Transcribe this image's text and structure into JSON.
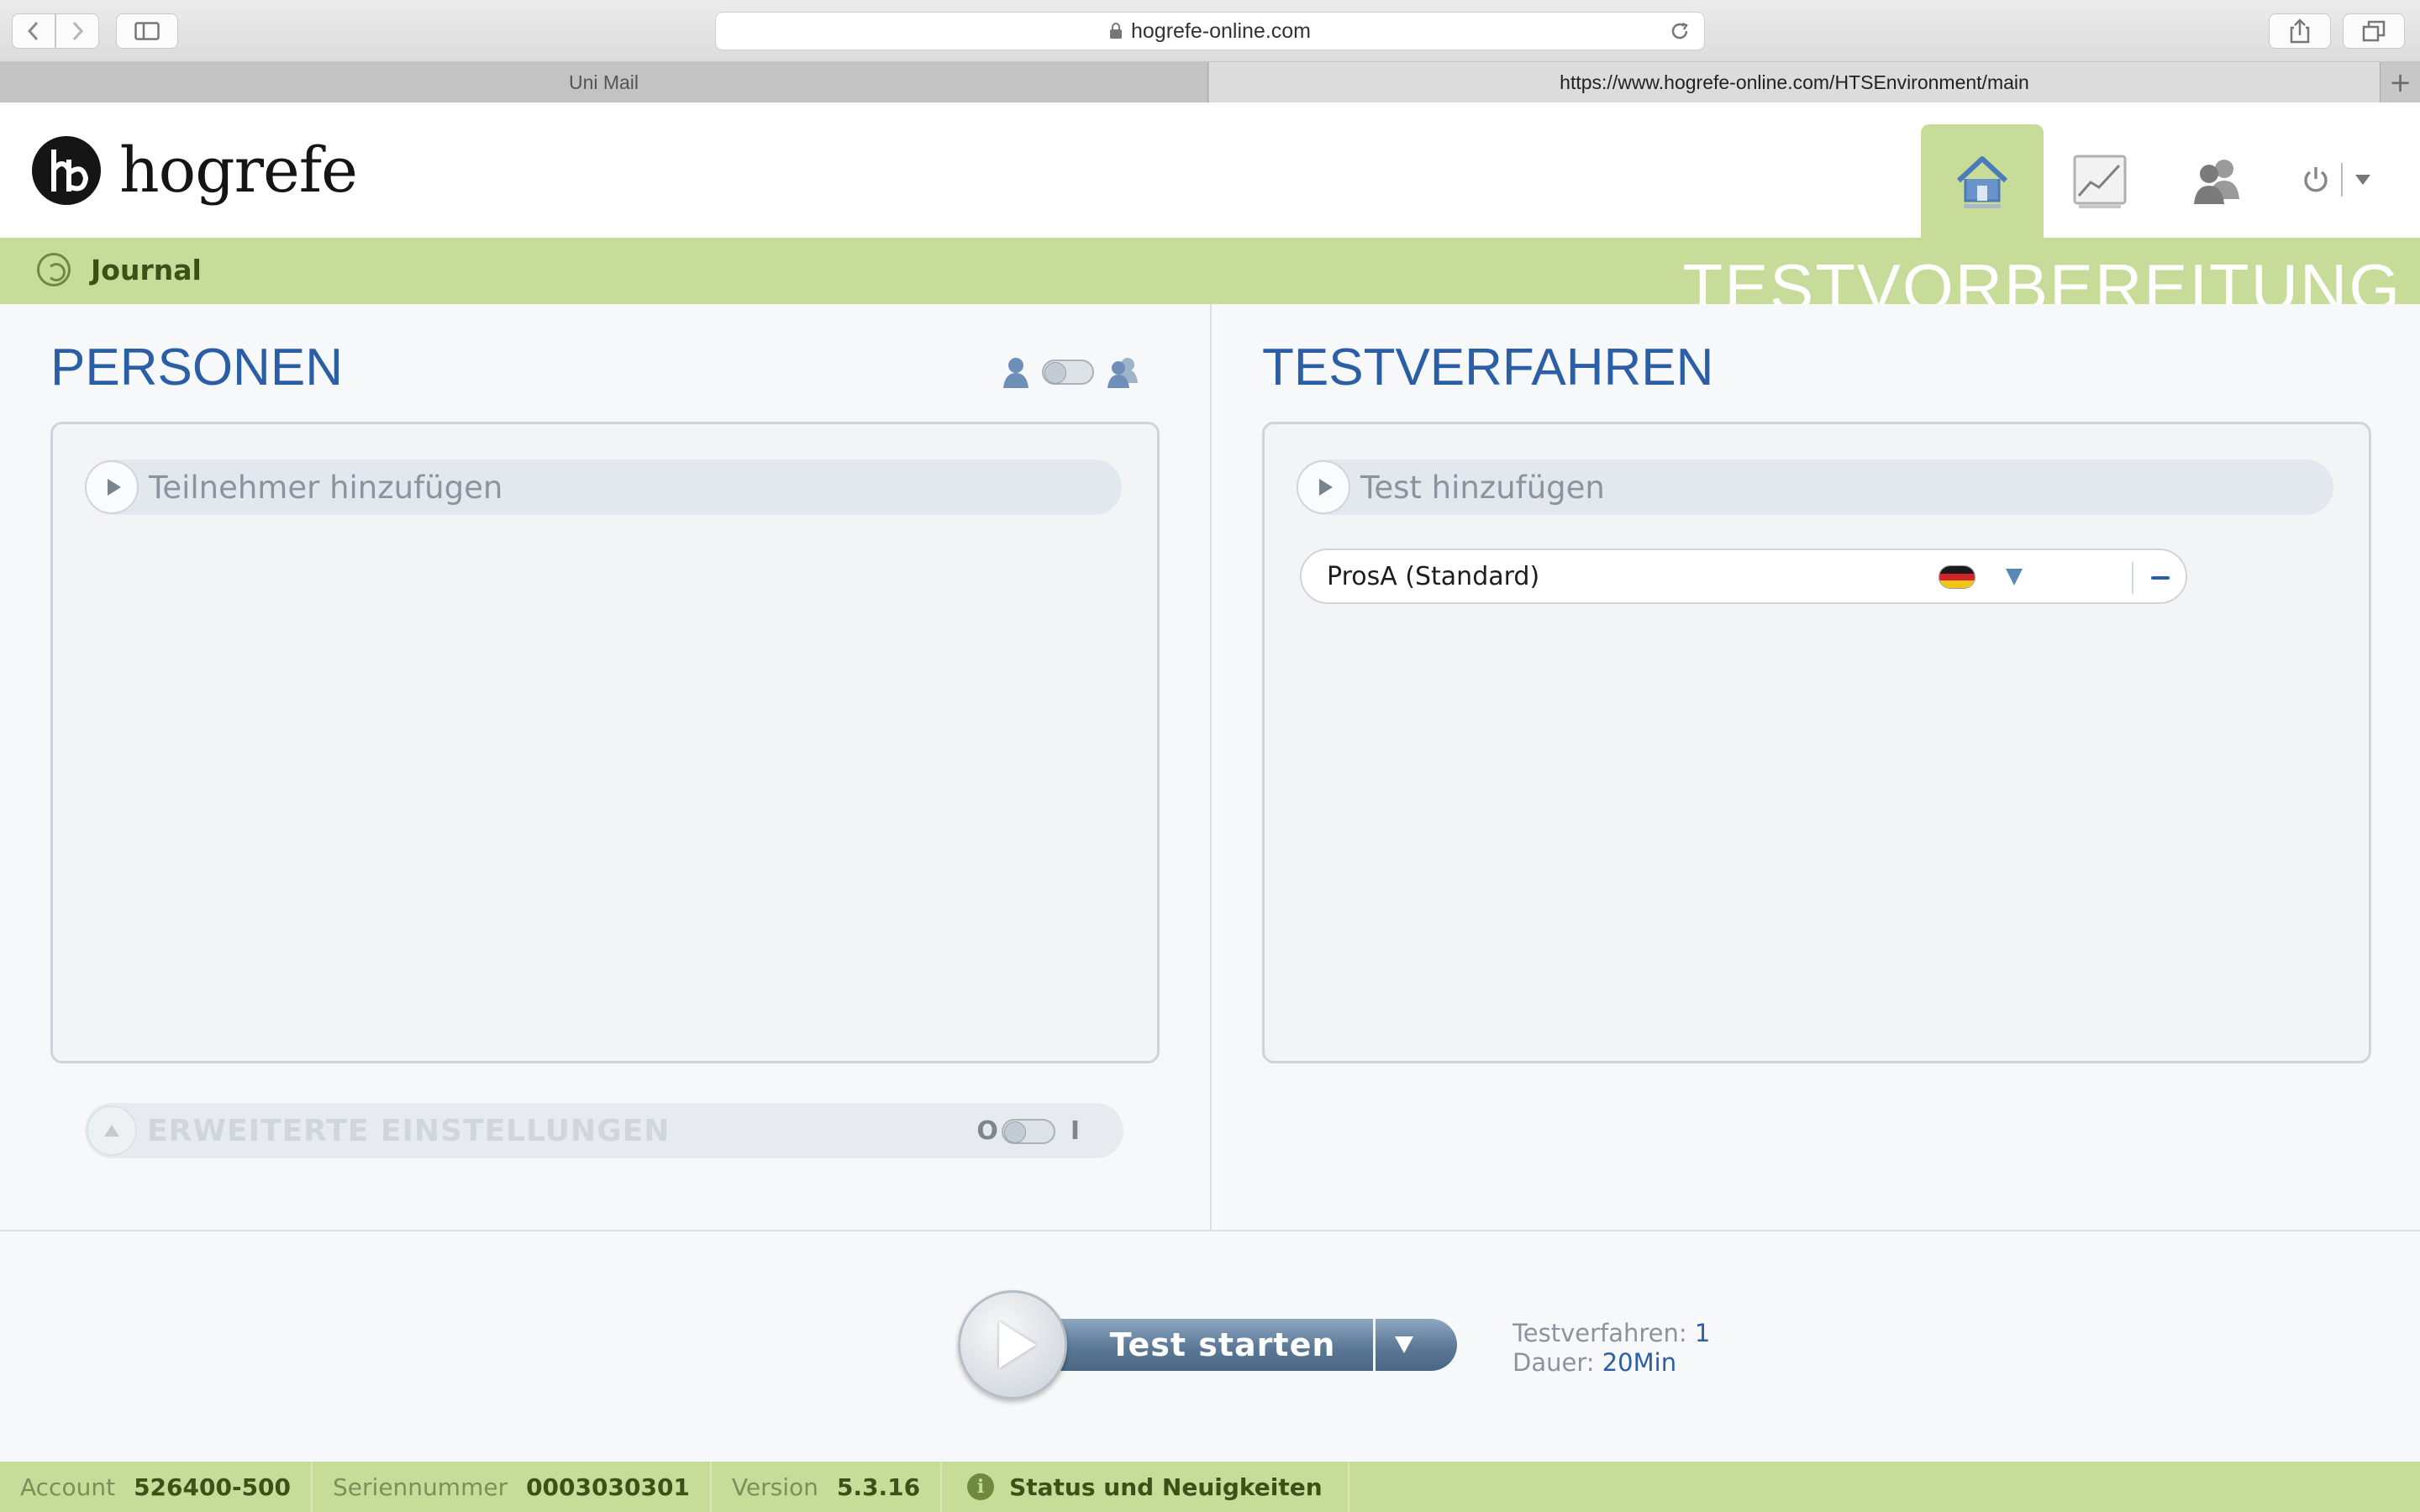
{
  "browser": {
    "url": "hogrefe-online.com",
    "tabs": [
      {
        "label": "Uni Mail"
      },
      {
        "label": "https://www.hogrefe-online.com/HTSEnvironment/main"
      }
    ]
  },
  "header": {
    "logo_text": "hogrefe",
    "nav": [
      "home-icon",
      "chart-icon",
      "users-icon",
      "power-icon"
    ]
  },
  "greenbar": {
    "journal_label": "Journal",
    "phase_title": "TESTVORBEREITUNG"
  },
  "persons": {
    "title": "PERSONEN",
    "add_label": "Teilnehmer hinzufügen",
    "advanced_label": "ERWEITERTE EINSTELLUNGEN",
    "toggle_off": "O",
    "toggle_on": "I"
  },
  "tests": {
    "title": "TESTVERFAHREN",
    "add_label": "Test hinzufügen",
    "items": [
      {
        "name": "ProsA (Standard)",
        "language_flag": "de"
      }
    ]
  },
  "action": {
    "start_label": "Test starten",
    "summary": {
      "count_key": "Testverfahren:",
      "count_value": "1",
      "duration_key": "Dauer:",
      "duration_value": "20Min"
    }
  },
  "footer": {
    "account_key": "Account",
    "account_value": "526400-500",
    "serial_key": "Seriennummer",
    "serial_value": "0003030301",
    "version_key": "Version",
    "version_value": "5.3.16",
    "status_label": "Status und Neuigkeiten"
  },
  "colors": {
    "accent_green": "#c8dc9a",
    "title_blue": "#2a5ea6",
    "button_blue": "#5b7896"
  }
}
